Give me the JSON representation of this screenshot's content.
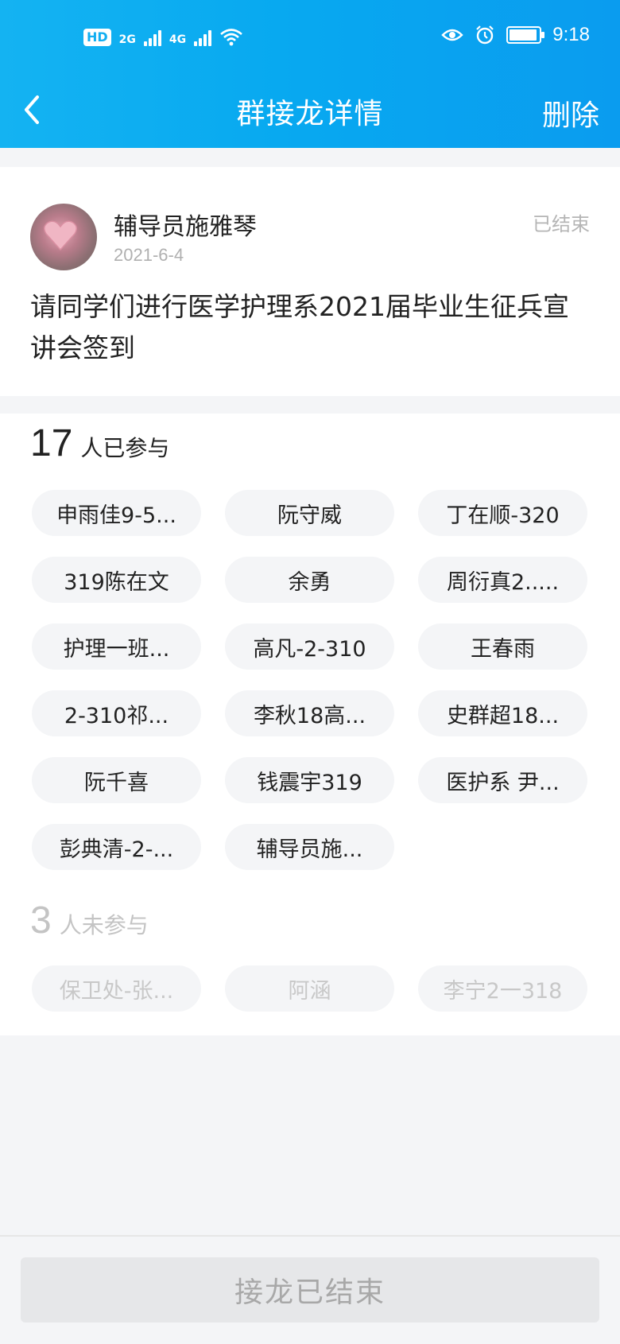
{
  "status_bar": {
    "hd_label": "HD",
    "net1": "2G",
    "net2": "4G",
    "time": "9:18",
    "icons": [
      "hd-icon",
      "signal-icon",
      "wifi-icon",
      "eye-icon",
      "alarm-icon",
      "battery-icon"
    ]
  },
  "nav": {
    "title": "群接龙详情",
    "delete_label": "删除"
  },
  "post": {
    "author": "辅导员施雅琴",
    "date": "2021-6-4",
    "status": "已结束",
    "description": "请同学们进行医学护理系2021届毕业生征兵宣讲会签到"
  },
  "joined": {
    "count": "17",
    "label": "人已参与",
    "names": [
      "申雨佳9-5...",
      "阮守威",
      "丁在顺-320",
      "319陈在文",
      "余勇",
      "周衍真2.....",
      "护理一班...",
      "高凡-2-310",
      "王春雨",
      "2-310祁...",
      "李秋18高...",
      "史群超18...",
      "阮千喜",
      "钱震宇319",
      "医护系 尹...",
      "彭典清-2-...",
      "辅导员施..."
    ]
  },
  "not_joined": {
    "count": "3",
    "label": "人未参与",
    "names": [
      "保卫处-张...",
      "阿涵",
      "李宁2一318"
    ]
  },
  "footer": {
    "button_label": "接龙已结束"
  },
  "colors": {
    "header_start": "#14b3f2",
    "header_end": "#0a9cef",
    "chip_bg": "#f4f5f7",
    "muted_text": "#c8c8c8"
  }
}
